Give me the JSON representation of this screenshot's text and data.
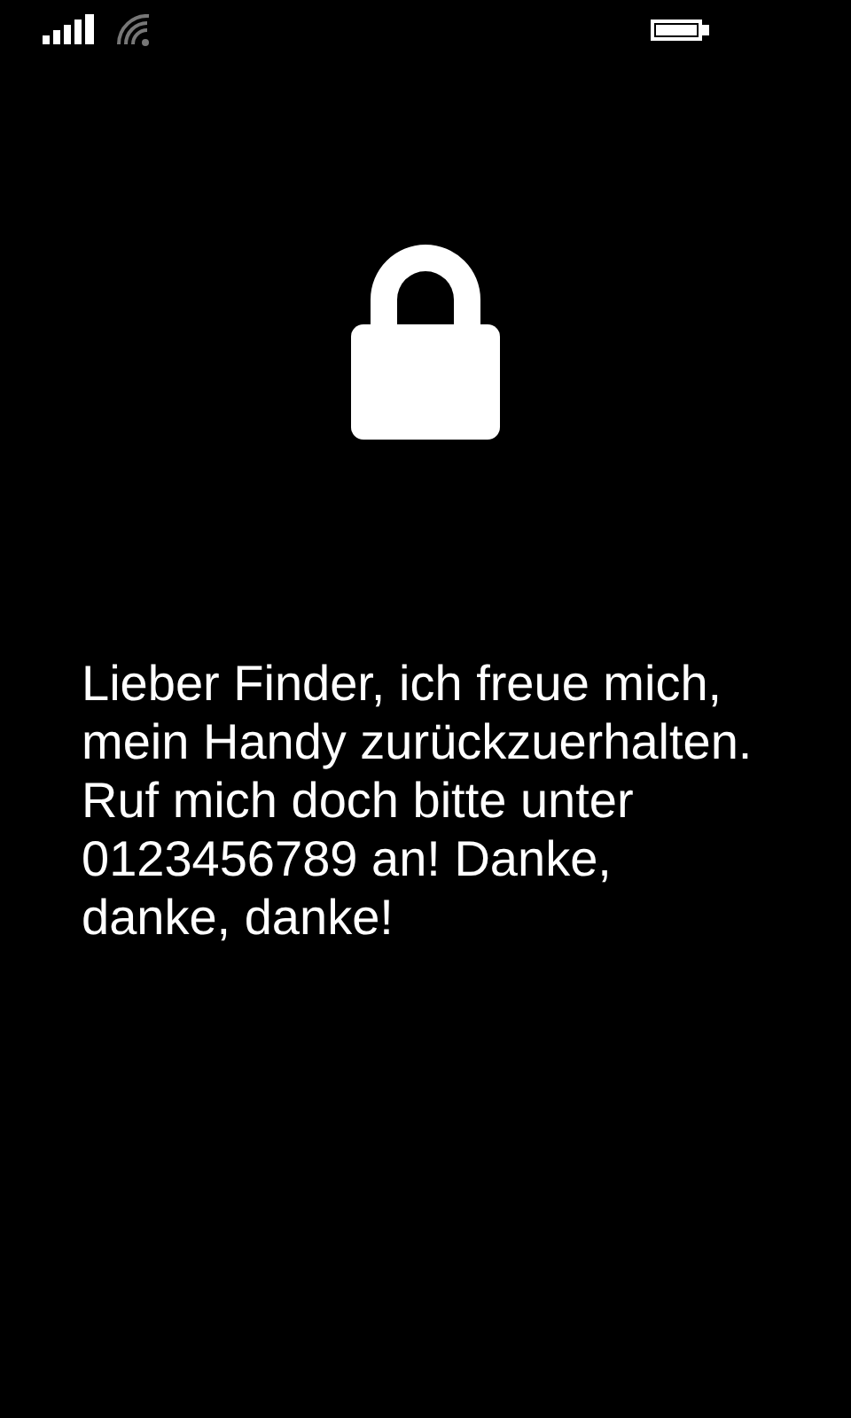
{
  "message": "Lieber Finder, ich freue mich, mein Handy zurückzuerhalten. Ruf mich doch bitte unter 0123456789 an! Danke, danke, danke!"
}
